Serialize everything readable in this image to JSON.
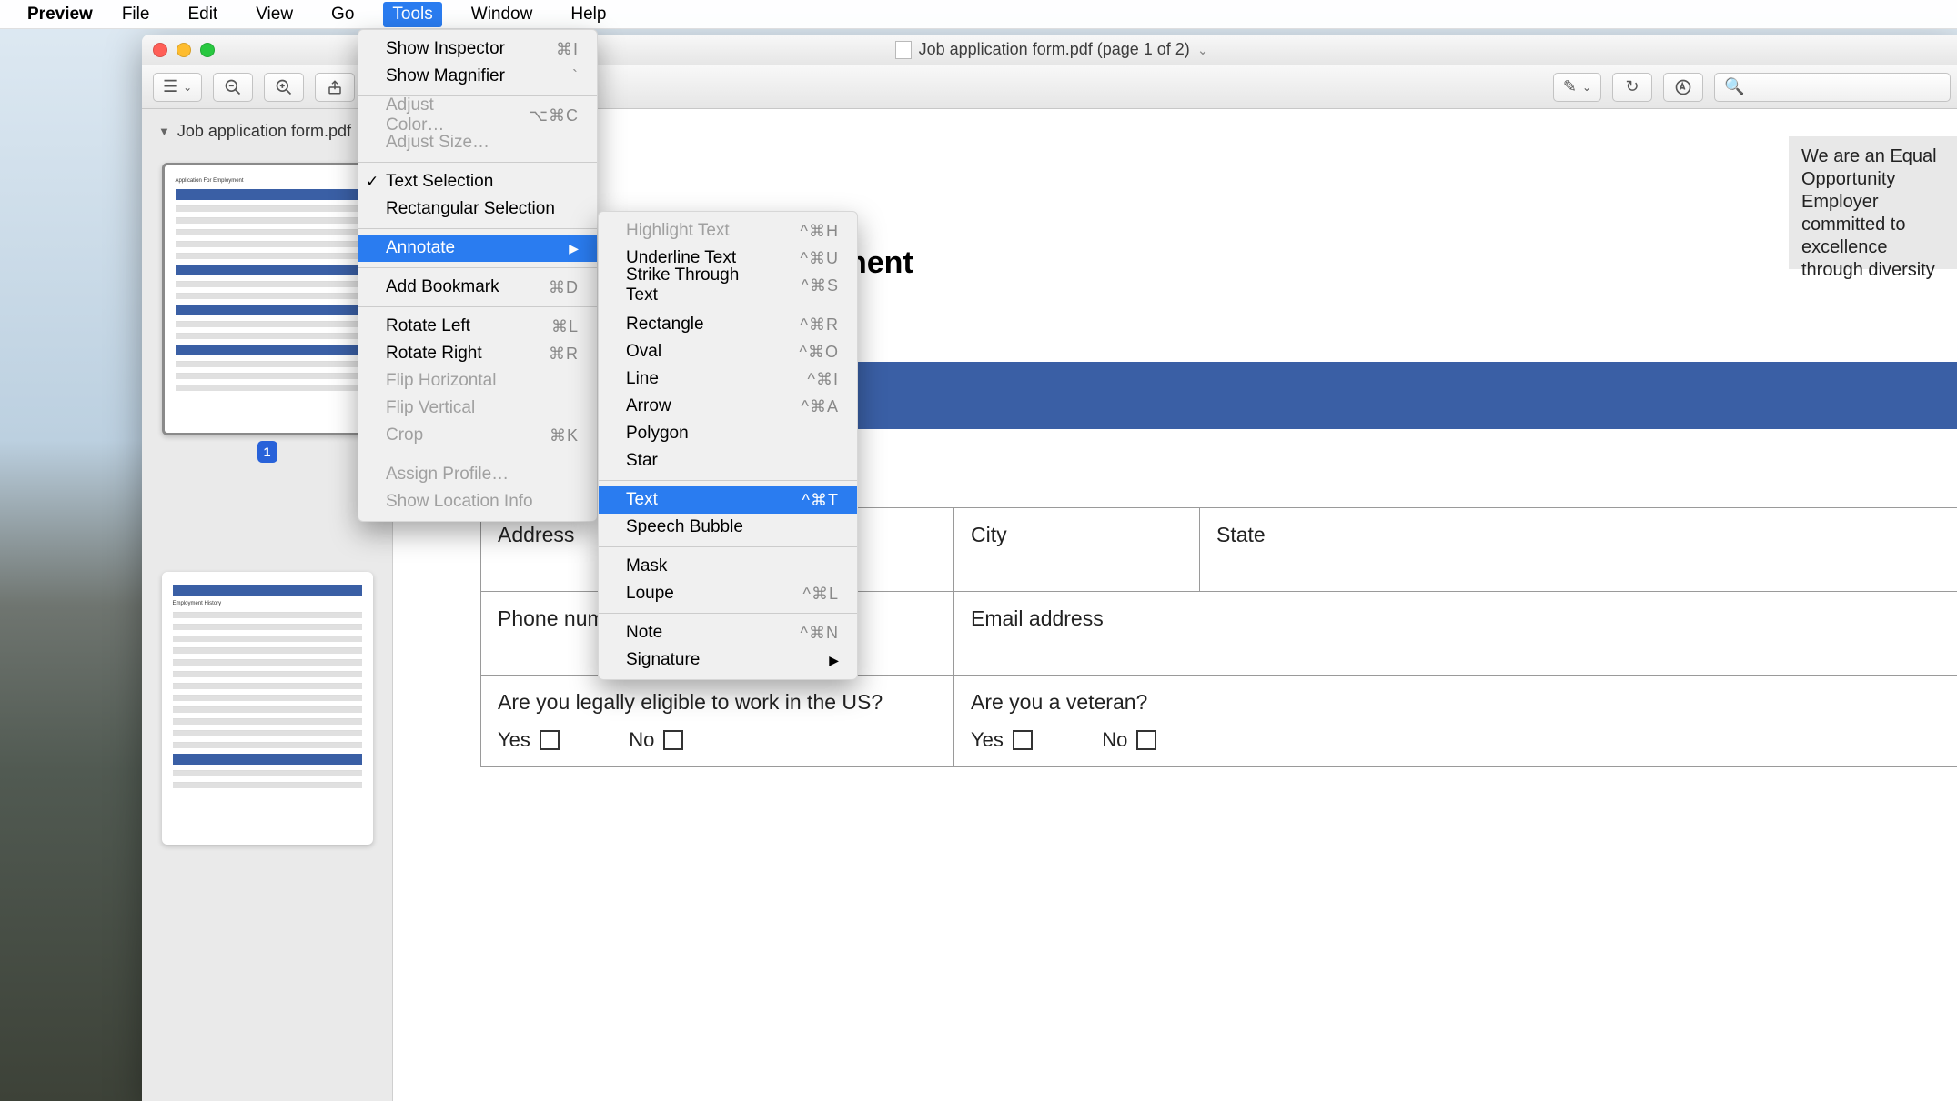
{
  "menubar": {
    "app": "Preview",
    "items": [
      "File",
      "Edit",
      "View",
      "Go",
      "Tools",
      "Window",
      "Help"
    ],
    "active_index": 4
  },
  "window": {
    "title": "Job application form.pdf (page 1 of 2)",
    "sidebar_title": "Job application form.pdf",
    "page_badge": "1"
  },
  "tools_menu": {
    "items": [
      {
        "label": "Show Inspector",
        "shortcut": "⌘I"
      },
      {
        "label": "Show Magnifier",
        "shortcut": "`"
      },
      {
        "sep": true
      },
      {
        "label": "Adjust Color…",
        "shortcut": "⌥⌘C",
        "disabled": true
      },
      {
        "label": "Adjust Size…",
        "shortcut": "",
        "disabled": true
      },
      {
        "sep": true
      },
      {
        "label": "Text Selection",
        "checked": true
      },
      {
        "label": "Rectangular Selection"
      },
      {
        "sep": true
      },
      {
        "label": "Annotate",
        "submenu": true,
        "highlight": true
      },
      {
        "sep": true
      },
      {
        "label": "Add Bookmark",
        "shortcut": "⌘D"
      },
      {
        "sep": true
      },
      {
        "label": "Rotate Left",
        "shortcut": "⌘L"
      },
      {
        "label": "Rotate Right",
        "shortcut": "⌘R"
      },
      {
        "label": "Flip Horizontal",
        "disabled": true
      },
      {
        "label": "Flip Vertical",
        "disabled": true
      },
      {
        "label": "Crop",
        "shortcut": "⌘K",
        "disabled": true
      },
      {
        "sep": true
      },
      {
        "label": "Assign Profile…",
        "disabled": true
      },
      {
        "label": "Show Location Info",
        "disabled": true
      }
    ]
  },
  "annotate_menu": {
    "items": [
      {
        "label": "Highlight Text",
        "shortcut": "^⌘H",
        "disabled": true
      },
      {
        "label": "Underline Text",
        "shortcut": "^⌘U"
      },
      {
        "label": "Strike Through Text",
        "shortcut": "^⌘S"
      },
      {
        "sep": true
      },
      {
        "label": "Rectangle",
        "shortcut": "^⌘R"
      },
      {
        "label": "Oval",
        "shortcut": "^⌘O"
      },
      {
        "label": "Line",
        "shortcut": "^⌘I"
      },
      {
        "label": "Arrow",
        "shortcut": "^⌘A"
      },
      {
        "label": "Polygon"
      },
      {
        "label": "Star"
      },
      {
        "sep": true
      },
      {
        "label": "Text",
        "shortcut": "^⌘T",
        "highlight": true
      },
      {
        "label": "Speech Bubble"
      },
      {
        "sep": true
      },
      {
        "label": "Mask"
      },
      {
        "label": "Loupe",
        "shortcut": "^⌘L"
      },
      {
        "sep": true
      },
      {
        "label": "Note",
        "shortcut": "^⌘N"
      },
      {
        "label": "Signature",
        "submenu": true
      }
    ]
  },
  "document": {
    "eo_text": "We are an Equal Opportunity Employer committed to excellence through diversity",
    "heading_fragment": "nent",
    "row_address": {
      "label": "Address",
      "city": "City",
      "state": "State"
    },
    "row_phone": {
      "label": "Phone number",
      "email": "Email address"
    },
    "row_eligible": {
      "label": "Are you legally eligible to work in the US?",
      "yes": "Yes",
      "no": "No"
    },
    "row_veteran": {
      "label": "Are you a veteran?",
      "yes": "Yes",
      "no": "No"
    },
    "thumb1_title": "Application For Employment",
    "thumb2_title": "Employment History"
  }
}
